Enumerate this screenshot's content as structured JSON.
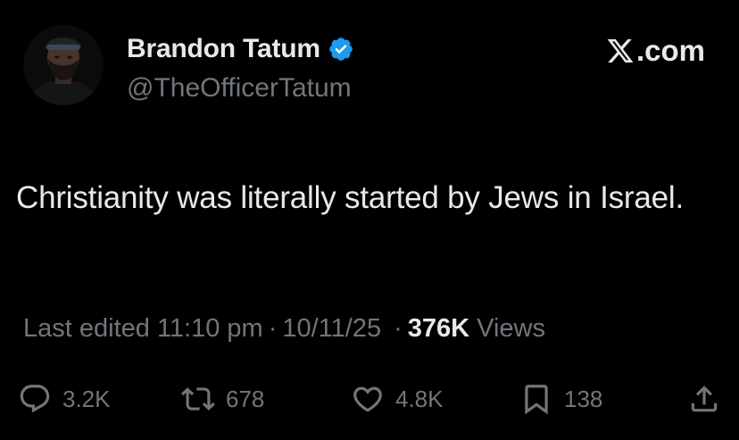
{
  "author": {
    "name": "Brandon Tatum",
    "handle": "@TheOfficerTatum",
    "verified": true,
    "verified_color": "#1d9bf0"
  },
  "brand": {
    "label": ".com",
    "icon": "x-logo-icon"
  },
  "tweet": {
    "text": "Christianity was literally started by Jews in Israel."
  },
  "meta": {
    "edited_label": "Last edited",
    "time": "11:10 pm",
    "separator": "·",
    "date": "10/11/25",
    "views_count": "376K",
    "views_label": "Views"
  },
  "actions": {
    "reply": {
      "icon": "reply-icon",
      "count": "3.2K"
    },
    "repost": {
      "icon": "repost-icon",
      "count": "678"
    },
    "like": {
      "icon": "heart-icon",
      "count": "4.8K"
    },
    "bookmark": {
      "icon": "bookmark-icon",
      "count": "138"
    },
    "share": {
      "icon": "share-icon"
    }
  },
  "colors": {
    "background": "#000000",
    "primary_text": "#e7e9ea",
    "secondary_text": "#71767b"
  }
}
